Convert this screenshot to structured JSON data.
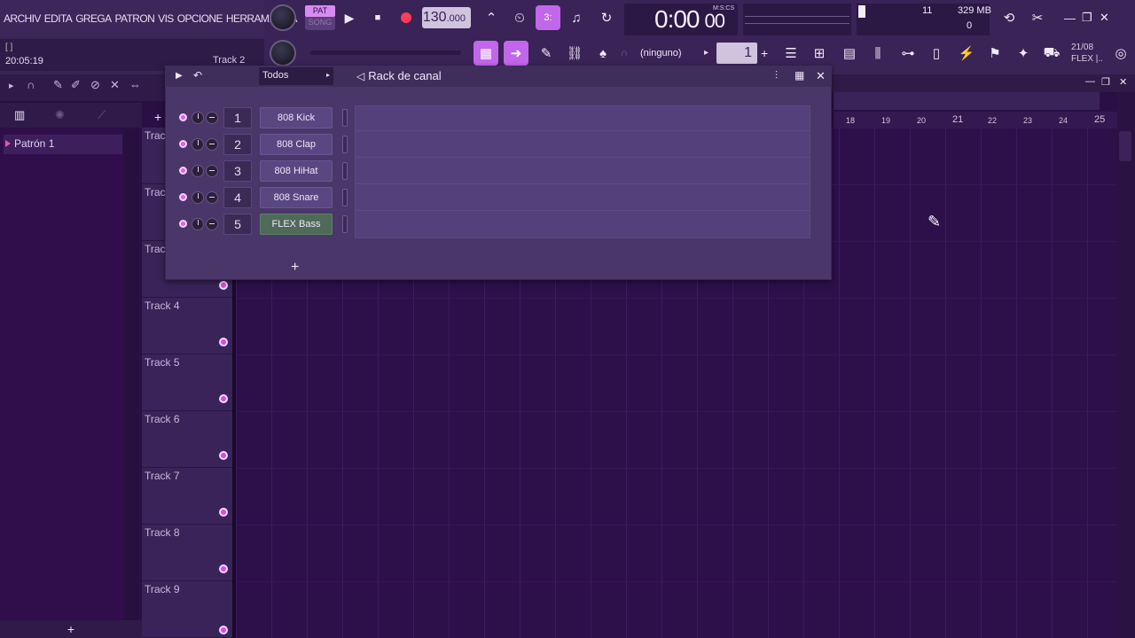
{
  "menu": {
    "items": [
      "ARCHIVO",
      "EDITAR",
      "AGREGAR",
      "PATRON",
      "VISTA",
      "OPCIONES",
      "HERRAMIENTAS"
    ],
    "display": [
      "ARCHIV",
      "EDITA",
      "GREGA",
      "PATRON",
      "VIS",
      "OPCIONE",
      "HERRAMIENTA"
    ]
  },
  "hint": {
    "bracket": "[ ]",
    "time": "20:05:19",
    "track": "Track 2"
  },
  "transport": {
    "pat_label": "PAT",
    "song_label": "SONG",
    "play_icon": "▶",
    "stop_icon": "■",
    "bpm": "130",
    "bpm_dec": ".000"
  },
  "time": {
    "main": "0:00",
    "cs": "00",
    "format": "M:S:CS"
  },
  "monitor": {
    "cpu": "11",
    "memory": "329 MB",
    "polyphony": "0"
  },
  "pattern": {
    "selector": "(ninguno)",
    "number": "1"
  },
  "version": {
    "date": "21/08",
    "label": "FLEX |.."
  },
  "browser": {
    "item": "Patrón 1",
    "add": "+"
  },
  "rack": {
    "filter": "Todos",
    "title": "Rack de canal",
    "add": "+",
    "channels": [
      {
        "num": "1",
        "name": "808 Kick"
      },
      {
        "num": "2",
        "name": "808 Clap"
      },
      {
        "num": "3",
        "name": "808 HiHat"
      },
      {
        "num": "4",
        "name": "808 Snare"
      },
      {
        "num": "5",
        "name": "FLEX Bass"
      }
    ]
  },
  "playlist": {
    "tracks": [
      "Trac",
      "Trac",
      "Trac",
      "Track 4",
      "Track 5",
      "Track 6",
      "Track 7",
      "Track 8",
      "Track 9"
    ],
    "ruler": [
      "18",
      "19",
      "20",
      "21",
      "22",
      "23",
      "24",
      "25"
    ],
    "add": "+"
  },
  "colors": {
    "accent": "#c266ea",
    "background": "#2a0f45",
    "record": "#ff3d5a"
  }
}
